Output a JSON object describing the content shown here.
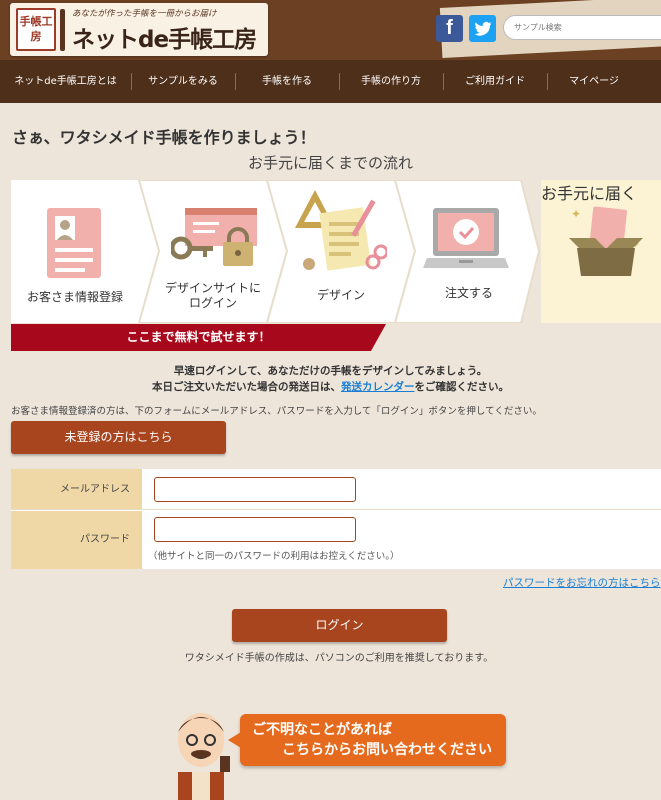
{
  "header": {
    "logo_mark": "手帳工房",
    "tagline": "あなたが作った手帳を一冊からお届け",
    "site_name": "ネットde手帳工房",
    "facebook_icon": "f",
    "search_placeholder": "サンプル検索"
  },
  "nav": {
    "items": [
      "ネットde手帳工房とは",
      "サンプルをみる",
      "手帳を作る",
      "手帳の作り方",
      "ご利用ガイド",
      "マイページ"
    ]
  },
  "main": {
    "title": "さぁ、ワタシメイド手帳を作りましょう！",
    "subtitle": "お手元に届くまでの流れ",
    "steps": [
      {
        "label": "お客さま情報登録",
        "icon": "profile-card-icon"
      },
      {
        "label": "デザインサイトに",
        "label2": "ログイン",
        "icon": "key-lock-icon"
      },
      {
        "label": "デザイン",
        "icon": "design-tools-icon"
      },
      {
        "label": "注文する",
        "icon": "laptop-check-icon"
      },
      {
        "label": "お手元に届く",
        "icon": "delivery-box-icon"
      }
    ],
    "free_banner": "ここまで無料で試せます！",
    "lead1": "早速ログインして、あなただけの手帳をデザインしてみましょう。",
    "lead2_pre": "本日ご注文いただいた場合の発送日は、",
    "lead2_link": "発送カレンダー",
    "lead2_post": "をご確認ください。",
    "note": "お客さま情報登録済の方は、下のフォームにメールアドレス、パスワードを入力して「ログイン」ボタンを押してください。",
    "register_button": "未登録の方はこちら"
  },
  "form": {
    "email_label": "メールアドレス",
    "password_label": "パスワード",
    "password_hint": "（他サイトと同一のパスワードの利用はお控えください。）",
    "forgot_link": "パスワードをお忘れの方はこちら",
    "login_button": "ログイン",
    "recommend": "ワタシメイド手帳の作成は、パソコンのご利用を推奨しております。"
  },
  "contact": {
    "line1": "ご不明なことがあれば",
    "line2": "こちらからお問い合わせください"
  },
  "colors": {
    "header_bg": "#6b4023",
    "nav_bg": "#4e2f1a",
    "accent_brown": "#a8451f",
    "banner_red": "#a8081b",
    "label_bg": "#efd8a6",
    "contact_orange": "#e66a1e",
    "link_blue": "#1a7fd4"
  }
}
